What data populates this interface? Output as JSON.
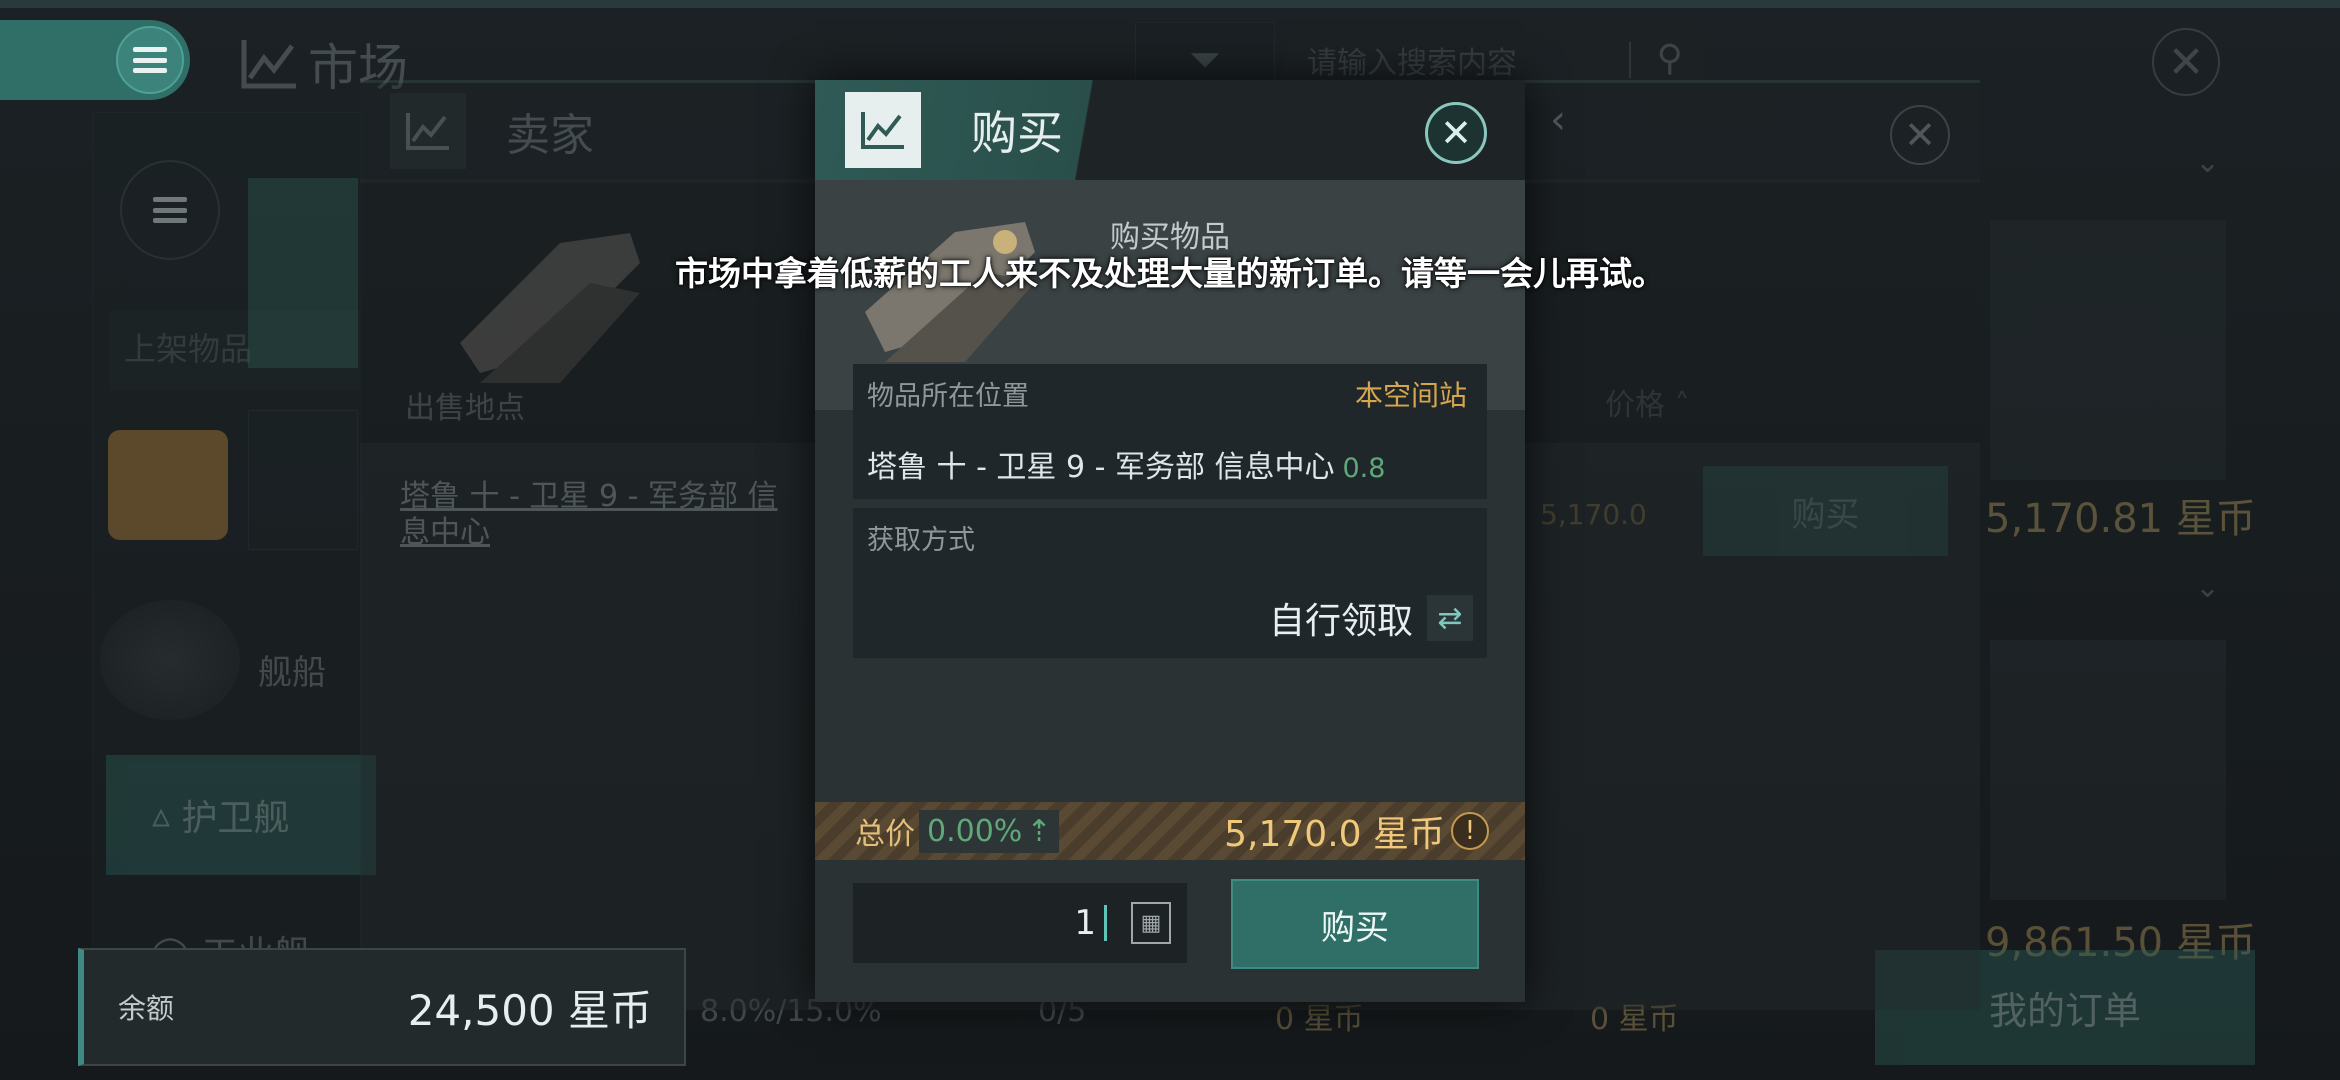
{
  "market": {
    "title": "市场",
    "search_placeholder": "请输入搜索内容",
    "listing_tab": "上架物品",
    "category_ship": "舰船",
    "category_frigate": "护卫舰",
    "category_industrial": "工业舰",
    "sort_label": "价格",
    "row_price": "5,170.0",
    "row_buy": "购买",
    "card_price_1": "5,170.81 星币",
    "card_price_2": "9,861.50 星币",
    "stat_tax": "8.0%/15.0%",
    "stat_orders": "0/5",
    "stat_coin_1": "0 星币",
    "stat_coin_2": "0 星币",
    "my_orders": "我的订单"
  },
  "seller": {
    "title": "卖家",
    "sell_location_header": "出售地点",
    "sell_location": "塔鲁 十 - 卫星 9 - 军务部 信息中心"
  },
  "dialog": {
    "title": "购买",
    "section_title": "购买物品",
    "location_label": "物品所在位置",
    "location_tag": "本空间站",
    "location_value": "塔鲁 十 - 卫星 9 - 军务部 信息中心",
    "security": "0.8",
    "acquire_label": "获取方式",
    "acquire_value": "自行领取",
    "total_label": "总价",
    "total_pct": "0.00%",
    "total_amount": "5,170.0 星币",
    "quantity": "1",
    "buy_label": "购买"
  },
  "toast": {
    "message": "市场中拿着低薪的工人来不及处理大量的新订单。请等一会儿再试。"
  },
  "balance": {
    "label": "余额",
    "value": "24,500 星币"
  }
}
